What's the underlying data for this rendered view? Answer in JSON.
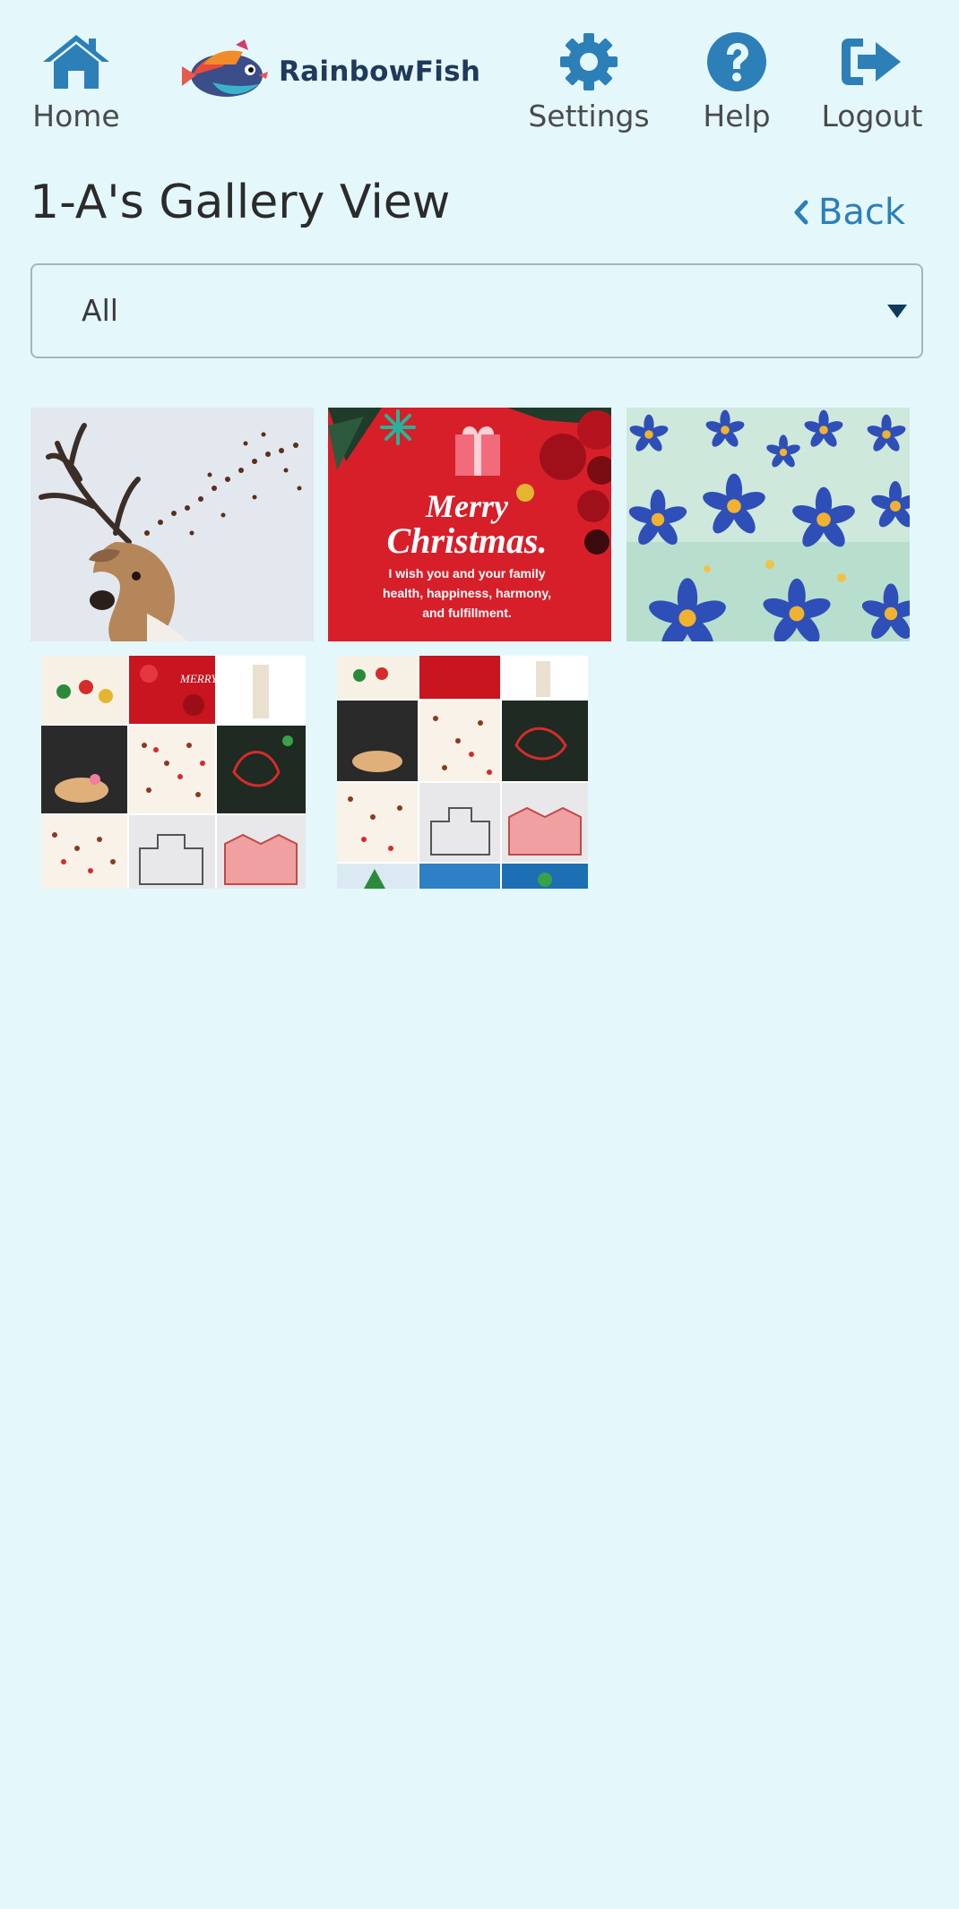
{
  "nav": {
    "home_label": "Home",
    "settings_label": "Settings",
    "help_label": "Help",
    "logout_label": "Logout",
    "brand_name": "RainbowFish",
    "icon_color": "#2d7fb8"
  },
  "page": {
    "title": "1-A's Gallery View",
    "back_label": "Back"
  },
  "filter": {
    "selected": "All"
  },
  "gallery": {
    "items": [
      {
        "name": "deer-with-ant-antlers",
        "icon": "deer-artwork"
      },
      {
        "name": "merry-christmas-card",
        "title_line1": "Merry",
        "title_line2": "Christmas.",
        "message_line1": "I wish you and your family",
        "message_line2": "health, happiness, harmony,",
        "message_line3": "and fulfillment."
      },
      {
        "name": "blue-flowers-painting",
        "icon": "flowers-artwork"
      },
      {
        "name": "collage-grid-1",
        "icon": "collage"
      },
      {
        "name": "collage-grid-2",
        "icon": "collage"
      }
    ]
  },
  "colors": {
    "background": "#e4f8fc",
    "accent": "#2d7fb8",
    "christmas_red": "#d71f2a"
  }
}
